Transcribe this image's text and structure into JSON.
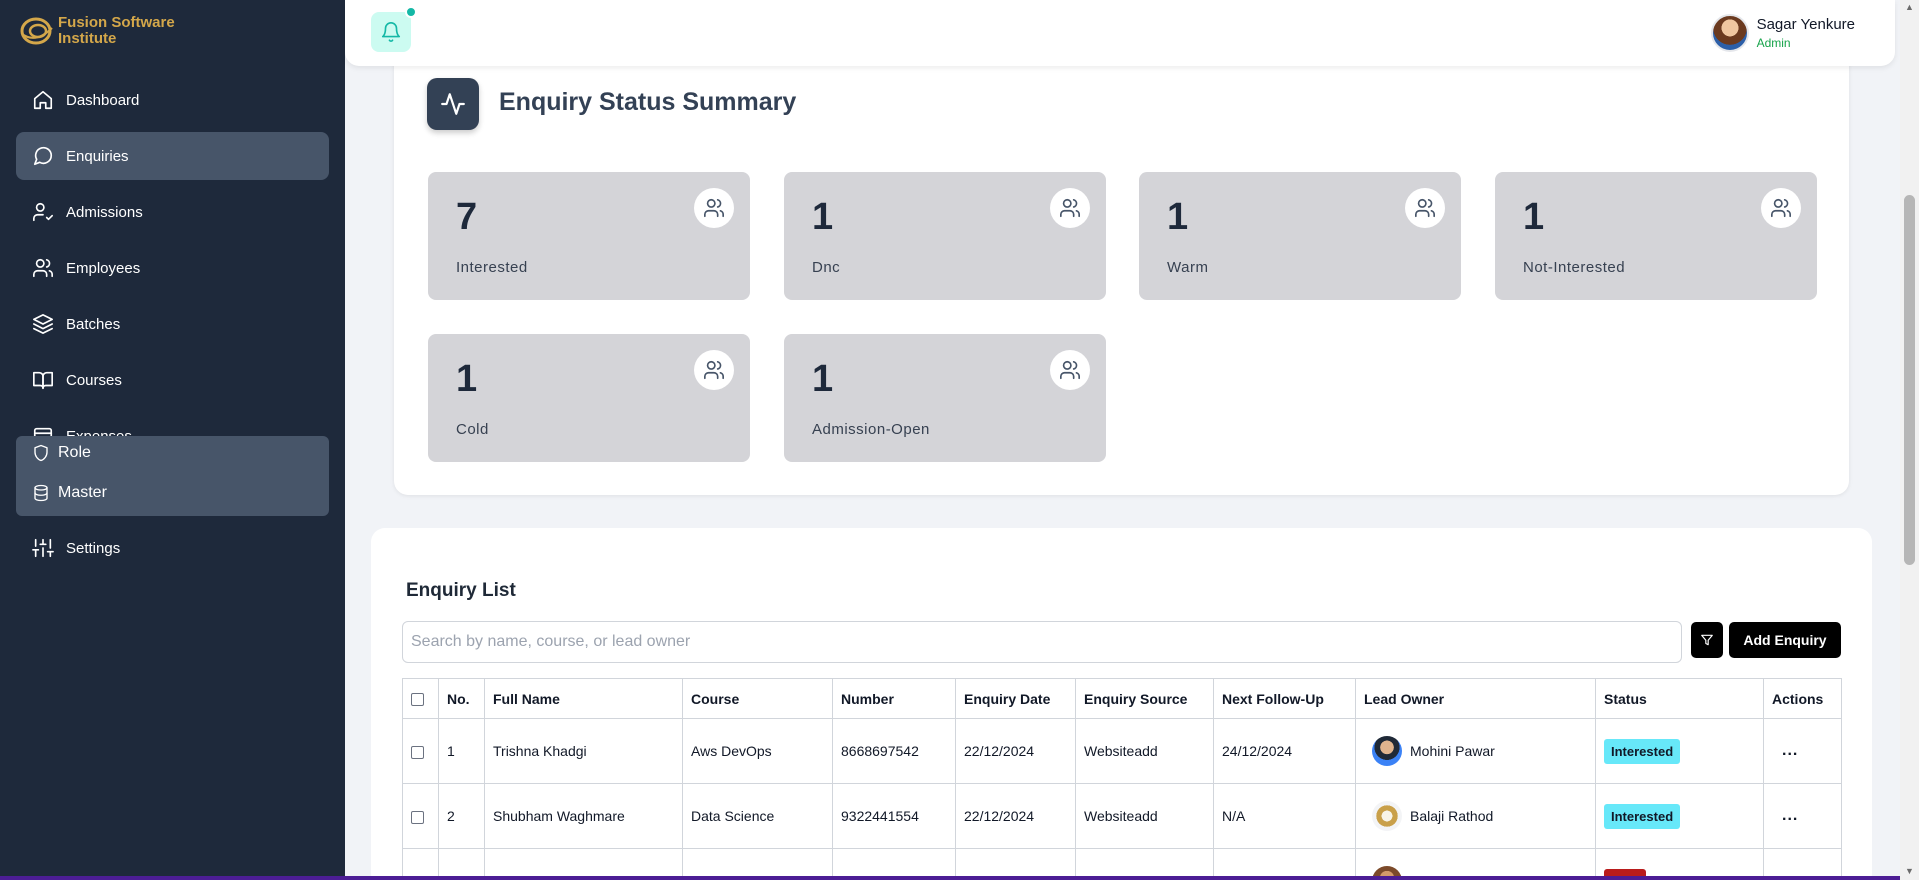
{
  "brand": {
    "line1": "Fusion Software",
    "line2": "Institute"
  },
  "sidebar": {
    "items": [
      {
        "label": "Dashboard",
        "icon": "home-icon"
      },
      {
        "label": "Enquiries",
        "icon": "message-circle-icon",
        "active": true
      },
      {
        "label": "Admissions",
        "icon": "user-check-icon"
      },
      {
        "label": "Employees",
        "icon": "users-icon"
      },
      {
        "label": "Batches",
        "icon": "layers-icon"
      },
      {
        "label": "Courses",
        "icon": "book-open-icon"
      },
      {
        "label": "Expenses",
        "icon": "receipt-icon"
      },
      {
        "label": "Settings",
        "icon": "sliders-icon"
      }
    ],
    "popover": [
      {
        "label": "Role",
        "icon": "shield-icon"
      },
      {
        "label": "Master",
        "icon": "database-icon"
      }
    ]
  },
  "topbar": {
    "user_name": "Sagar Yenkure",
    "user_role": "Admin",
    "bell_icon": "bell-icon"
  },
  "summary": {
    "title": "Enquiry Status Summary",
    "stats": [
      {
        "count": "7",
        "label": "Interested"
      },
      {
        "count": "1",
        "label": "Dnc"
      },
      {
        "count": "1",
        "label": "Warm"
      },
      {
        "count": "1",
        "label": "Not-Interested"
      },
      {
        "count": "1",
        "label": "Cold"
      },
      {
        "count": "1",
        "label": "Admission-Open"
      }
    ]
  },
  "enquiry_list": {
    "title": "Enquiry List",
    "search_placeholder": "Search by name, course, or lead owner",
    "add_button": "Add Enquiry",
    "columns": [
      "No.",
      "Full Name",
      "Course",
      "Number",
      "Enquiry Date",
      "Enquiry Source",
      "Next Follow-Up",
      "Lead Owner",
      "Status",
      "Actions"
    ],
    "rows": [
      {
        "no": "1",
        "name": "Trishna Khadgi",
        "course": "Aws DevOps",
        "number": "8668697542",
        "date": "22/12/2024",
        "source": "Websiteadd",
        "followup": "24/12/2024",
        "owner": "Mohini Pawar",
        "status": "Interested",
        "actions": "..."
      },
      {
        "no": "2",
        "name": "Shubham Waghmare",
        "course": "Data Science",
        "number": "9322441554",
        "date": "22/12/2024",
        "source": "Websiteadd",
        "followup": "N/A",
        "owner": "Balaji Rathod",
        "status": "Interested",
        "actions": "..."
      }
    ]
  },
  "colors": {
    "sidebar_bg": "#1e293b",
    "active_item": "#475569",
    "brand_gold": "#d4a74a",
    "accent_teal": "#14b8a6",
    "stat_card": "#d4d4d8",
    "status_interested": "#67e8f9"
  }
}
